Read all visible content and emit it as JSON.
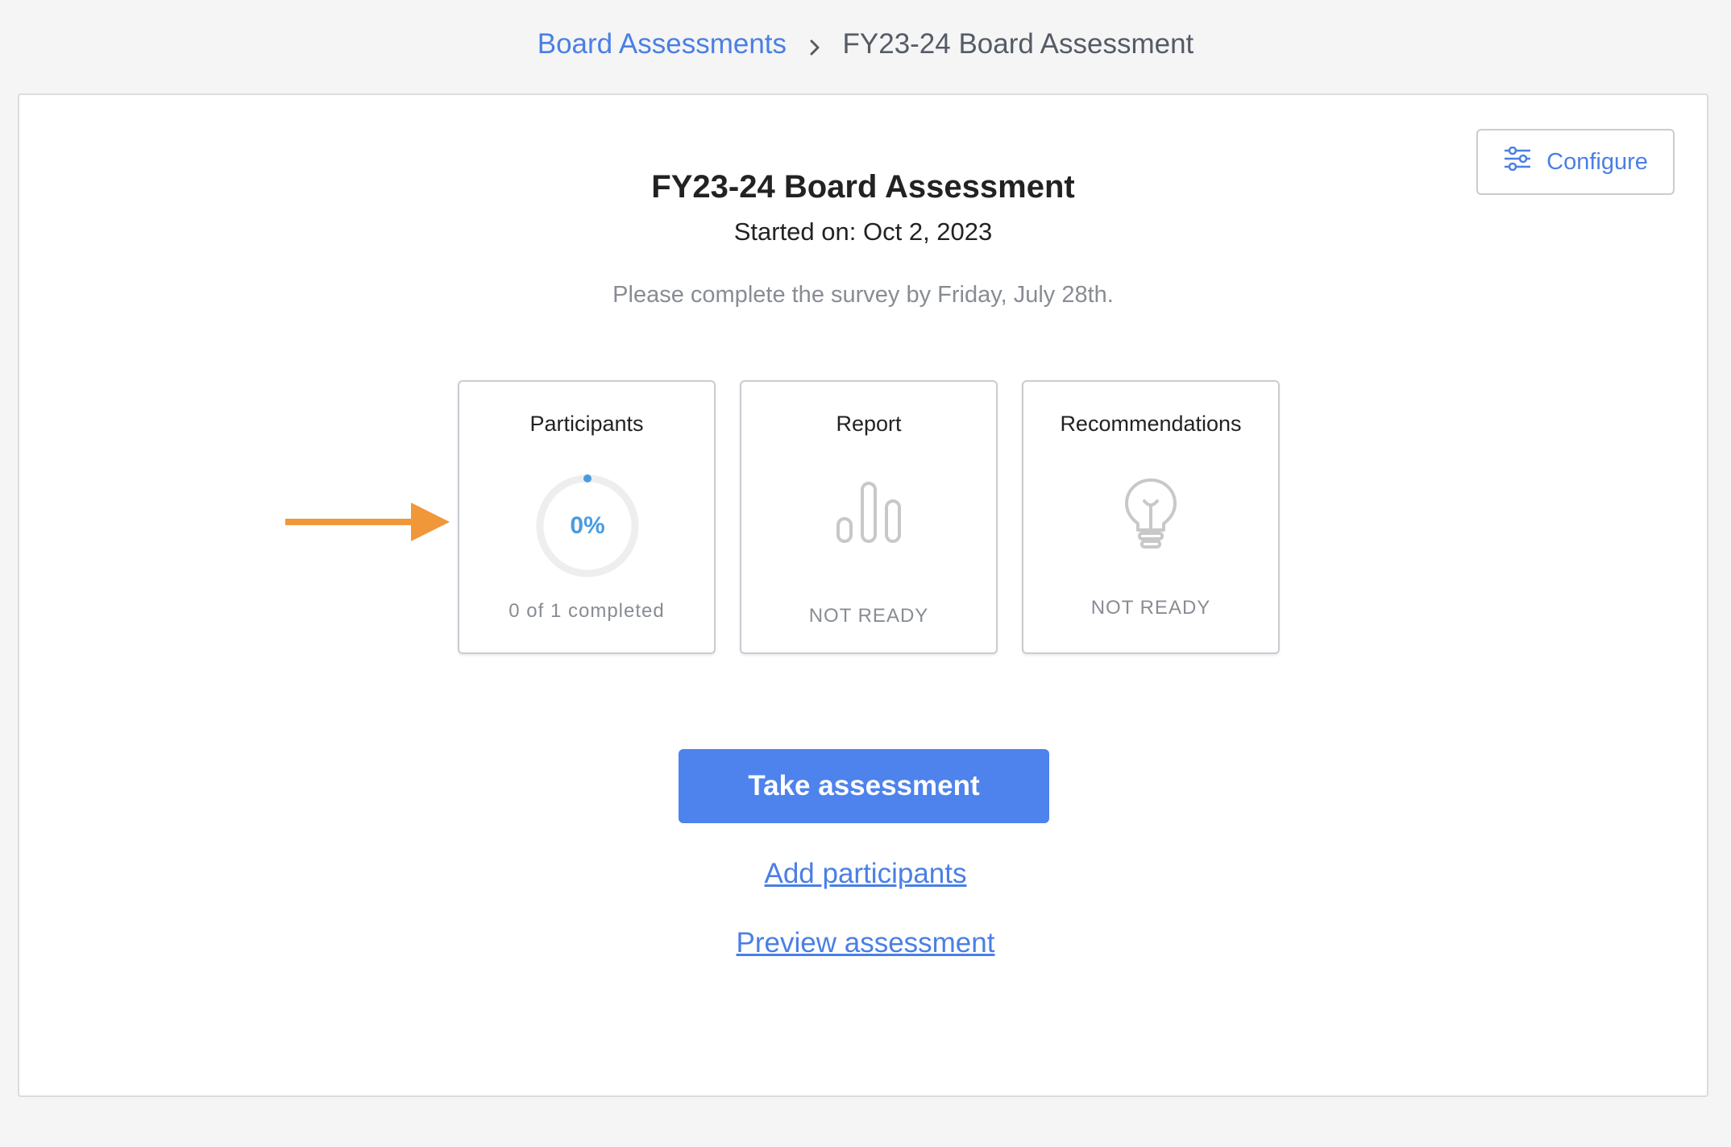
{
  "breadcrumb": {
    "parent": "Board Assessments",
    "current": "FY23-24 Board Assessment"
  },
  "header": {
    "title": "FY23-24 Board Assessment",
    "started": "Started on: Oct 2, 2023",
    "instructions": "Please complete the survey by Friday, July 28th."
  },
  "toolbar": {
    "configure_label": "Configure",
    "configure_icon": "sliders-icon"
  },
  "tiles": {
    "participants": {
      "title": "Participants",
      "percent_label": "0%",
      "progress_fraction": 0,
      "status": "0 of 1 completed"
    },
    "report": {
      "title": "Report",
      "icon": "bar-chart-icon",
      "status": "NOT READY"
    },
    "recommendations": {
      "title": "Recommendations",
      "icon": "lightbulb-icon",
      "status": "NOT READY"
    }
  },
  "actions": {
    "take_assessment": "Take assessment",
    "add_participants": "Add participants",
    "preview_assessment": "Preview assessment"
  },
  "colors": {
    "accent": "#4e82ed",
    "link": "#4a7fe5",
    "progress": "#4a9be0",
    "arrow": "#f0973a",
    "muted_icon": "#c8c8c8"
  }
}
